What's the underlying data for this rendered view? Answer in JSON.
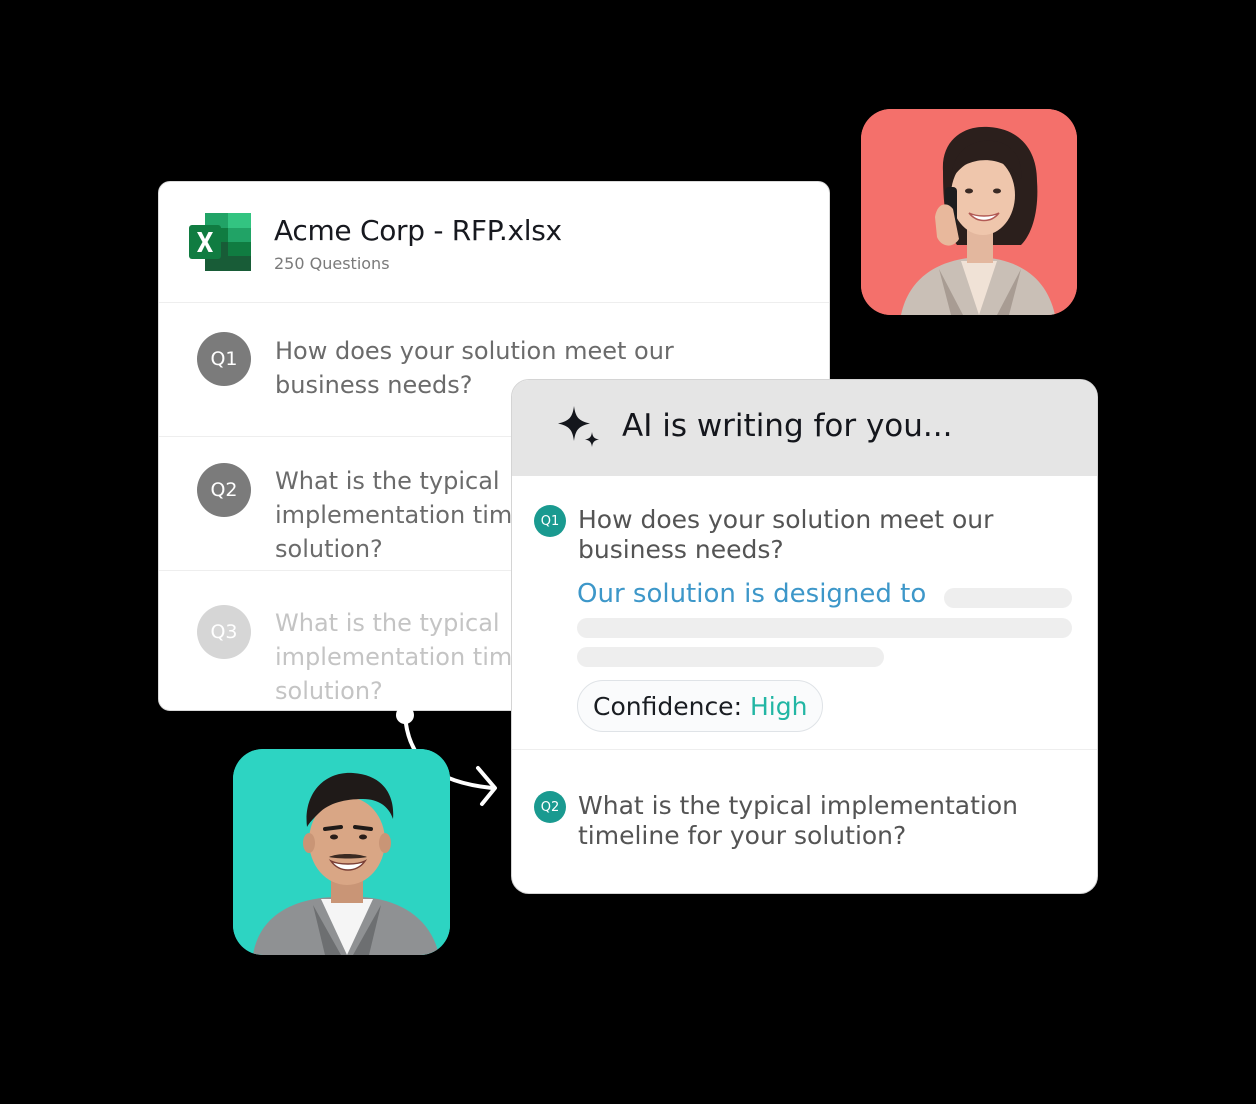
{
  "file_card": {
    "title": "Acme Corp - RFP.xlsx",
    "subtitle": "250 Questions",
    "icon": "excel-icon",
    "questions": [
      {
        "badge": "Q1",
        "text": "How does your solution meet our business needs?",
        "color": "#7b7b7b"
      },
      {
        "badge": "Q2",
        "text": "What is the typical implementation timeline for your solution?",
        "color": "#7b7b7b"
      },
      {
        "badge": "Q3",
        "text": "What is the typical implementation timeline for your solution?",
        "color": "#cfcfcf"
      }
    ]
  },
  "ai_card": {
    "title": "AI is writing for you...",
    "icon": "sparkle-icon",
    "q1": {
      "badge": "Q1",
      "text": "How does your solution meet our business needs?",
      "answer_lead": "Our solution is designed to",
      "confidence_label": "Confidence:",
      "confidence_value": "High"
    },
    "q2": {
      "badge": "Q2",
      "text": "What is the typical implementation timeline for your solution?"
    }
  },
  "colors": {
    "background": "#000000",
    "accent_teal": "#1a9a90",
    "confidence_high": "#22b6a4",
    "answer_blue": "#3d97c9",
    "avatar_woman_bg": "#f4706b",
    "avatar_man_bg": "#2dd4c2"
  }
}
